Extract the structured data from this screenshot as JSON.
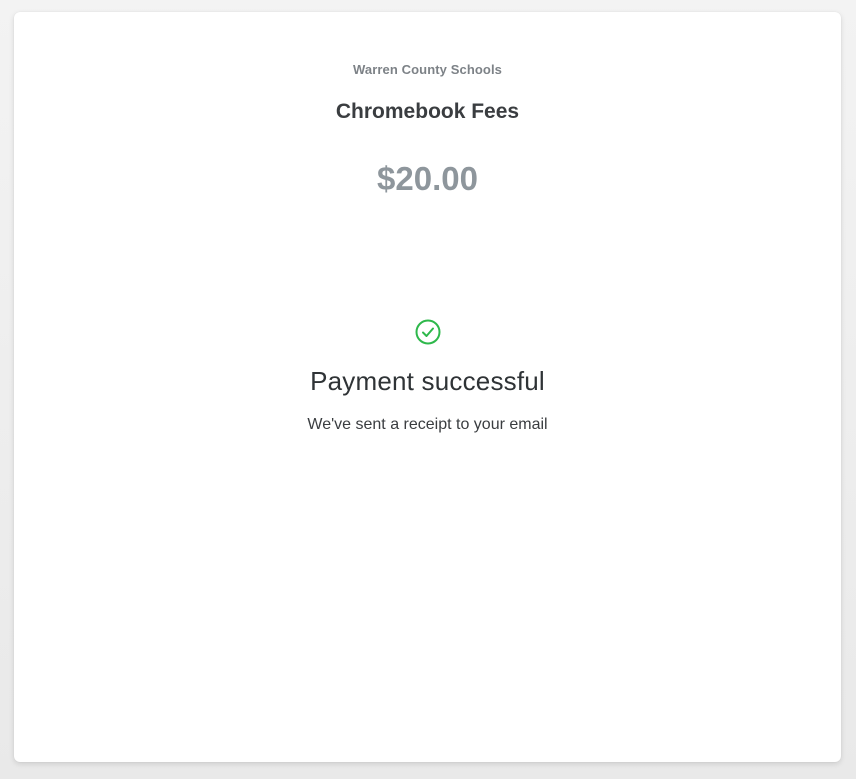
{
  "payment": {
    "merchant_name": "Warren County Schools",
    "item_title": "Chromebook Fees",
    "amount": "$20.00"
  },
  "status": {
    "icon": "check-circle-icon",
    "icon_color": "#2eb84b",
    "title": "Payment successful",
    "message": "We've sent a receipt to your email"
  }
}
